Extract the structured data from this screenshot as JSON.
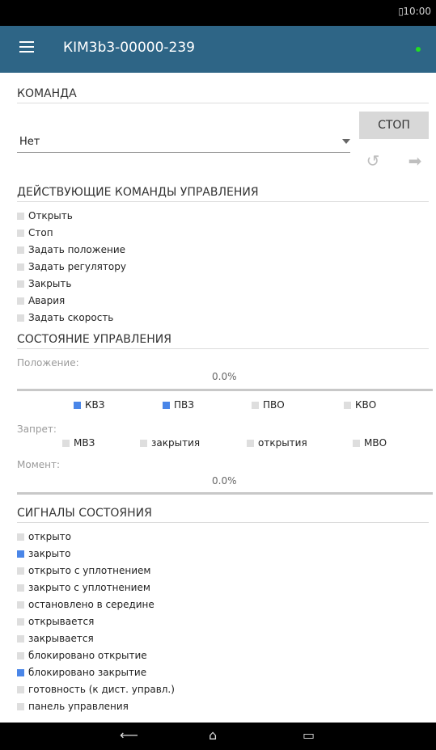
{
  "status_bar": {
    "time": "10:00",
    "bt_icon": "battery-icon"
  },
  "app_bar": {
    "title": "КІМ3b3-00000-239",
    "status_color": "#22dd22"
  },
  "command_section": {
    "title": "КОМАНДА",
    "select_value": "Нет",
    "stop_label": "СТОП"
  },
  "active_commands": {
    "title": "ДЕЙСТВУЮЩИЕ КОМАНДЫ УПРАВЛЕНИЯ",
    "items": [
      {
        "label": "Открыть",
        "checked": false
      },
      {
        "label": "Стоп",
        "checked": false
      },
      {
        "label": "Задать положение",
        "checked": false
      },
      {
        "label": "Задать регулятору",
        "checked": false
      },
      {
        "label": "Закрыть",
        "checked": false
      },
      {
        "label": "Авария",
        "checked": false
      },
      {
        "label": "Задать скорость",
        "checked": false
      }
    ]
  },
  "control_state": {
    "title": "СОСТОЯНИЕ УПРАВЛЕНИЯ",
    "position_label": "Положение:",
    "position_value": "0.0%",
    "position_fraction": 0.0,
    "limit_flags": [
      {
        "label": "КВЗ",
        "checked": true
      },
      {
        "label": "ПВЗ",
        "checked": true
      },
      {
        "label": "ПВО",
        "checked": false
      },
      {
        "label": "КВО",
        "checked": false
      }
    ],
    "prohibit_label": "Запрет:",
    "prohibit_flags": [
      {
        "label": "МВЗ",
        "checked": false
      },
      {
        "label": "закрытия",
        "checked": false
      },
      {
        "label": "открытия",
        "checked": false
      },
      {
        "label": "МВО",
        "checked": false
      }
    ],
    "torque_label": "Момент:",
    "torque_value": "0.0%",
    "torque_fraction": 0.0
  },
  "state_signals": {
    "title": "СИГНАЛЫ СОСТОЯНИЯ",
    "items": [
      {
        "label": "открыто",
        "checked": false
      },
      {
        "label": "закрыто",
        "checked": true
      },
      {
        "label": "открыто с уплотнением",
        "checked": false
      },
      {
        "label": "закрыто с уплотнением",
        "checked": false
      },
      {
        "label": "остановлено в середине",
        "checked": false
      },
      {
        "label": "открывается",
        "checked": false
      },
      {
        "label": "закрывается",
        "checked": false
      },
      {
        "label": "блокировано открытие",
        "checked": false
      },
      {
        "label": "блокировано закрытие",
        "checked": true
      },
      {
        "label": "готовность (к дист. управл.)",
        "checked": false
      },
      {
        "label": "панель управления",
        "checked": false
      }
    ]
  },
  "colors": {
    "accent": "#2e6586",
    "checked": "#4a86e8",
    "unchecked": "#dedede"
  }
}
